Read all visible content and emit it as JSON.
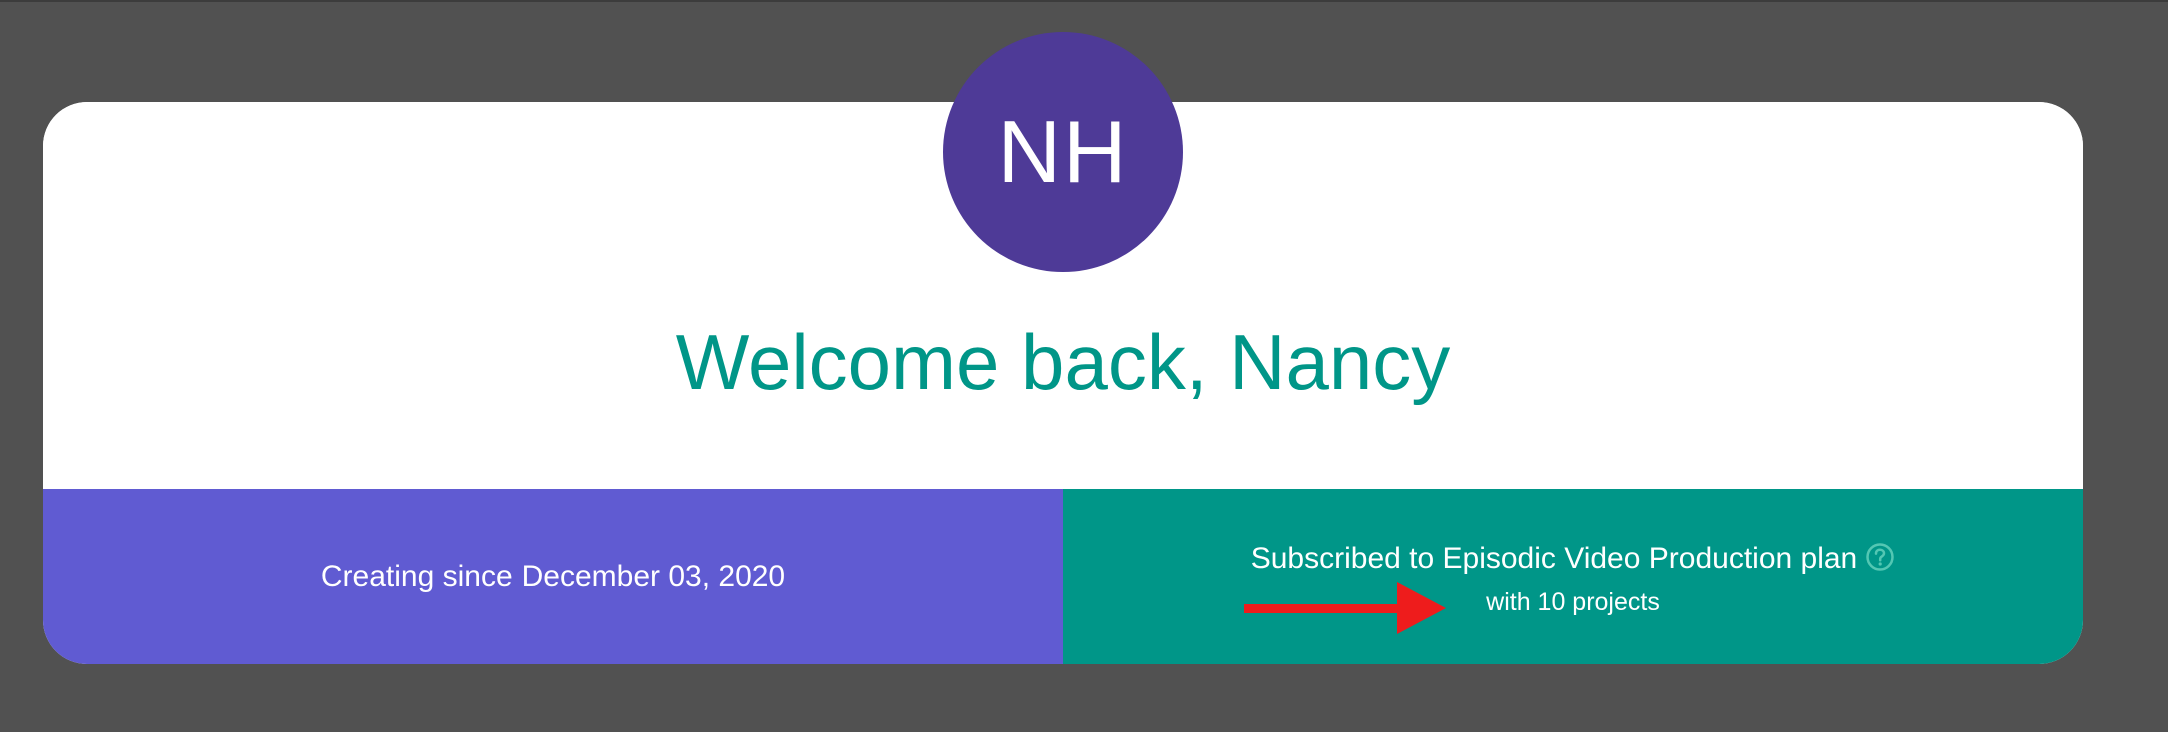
{
  "avatar": {
    "initials": "NH",
    "background": "#4e3a97"
  },
  "welcome": {
    "text": "Welcome back, Nancy",
    "color": "#009688"
  },
  "creating": {
    "label": "Creating since",
    "date": "December 03, 2020",
    "background": "#605bd2"
  },
  "subscription": {
    "text": "Subscribed to Episodic Video Production plan",
    "projects": "with 10 projects",
    "help_icon": "question-circle-icon",
    "background": "#009688"
  },
  "annotation": {
    "icon": "red-arrow-icon",
    "color": "#ee1c1c"
  }
}
